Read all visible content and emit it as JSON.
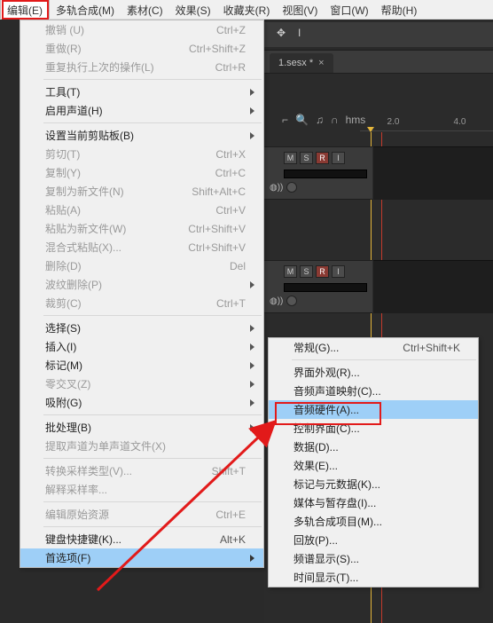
{
  "menubar": {
    "items": [
      {
        "label": "编辑(E)"
      },
      {
        "label": "多轨合成(M)"
      },
      {
        "label": "素材(C)"
      },
      {
        "label": "效果(S)"
      },
      {
        "label": "收藏夹(R)"
      },
      {
        "label": "视图(V)"
      },
      {
        "label": "窗口(W)"
      },
      {
        "label": "帮助(H)"
      }
    ]
  },
  "edit_menu": {
    "undo": {
      "label": "撤销 (U)",
      "shortcut": "Ctrl+Z"
    },
    "redo": {
      "label": "重做(R)",
      "shortcut": "Ctrl+Shift+Z"
    },
    "repeat": {
      "label": "重复执行上次的操作(L)",
      "shortcut": "Ctrl+R"
    },
    "tools": {
      "label": "工具(T)"
    },
    "enable_ch": {
      "label": "启用声道(H)"
    },
    "set_clipb": {
      "label": "设置当前剪贴板(B)"
    },
    "cut": {
      "label": "剪切(T)",
      "shortcut": "Ctrl+X"
    },
    "copy": {
      "label": "复制(Y)",
      "shortcut": "Ctrl+C"
    },
    "copy_new": {
      "label": "复制为新文件(N)",
      "shortcut": "Shift+Alt+C"
    },
    "paste": {
      "label": "粘贴(A)",
      "shortcut": "Ctrl+V"
    },
    "paste_new": {
      "label": "粘贴为新文件(W)",
      "shortcut": "Ctrl+Shift+V"
    },
    "mix_paste": {
      "label": "混合式粘贴(X)...",
      "shortcut": "Ctrl+Shift+V"
    },
    "delete": {
      "label": "删除(D)",
      "shortcut": "Del"
    },
    "ripple_del": {
      "label": "波纹删除(P)"
    },
    "crop": {
      "label": "裁剪(C)",
      "shortcut": "Ctrl+T"
    },
    "select": {
      "label": "选择(S)"
    },
    "insert": {
      "label": "插入(I)"
    },
    "marker": {
      "label": "标记(M)"
    },
    "zero_x": {
      "label": "零交叉(Z)"
    },
    "snap": {
      "label": "吸附(G)"
    },
    "batch": {
      "label": "批处理(B)"
    },
    "extract": {
      "label": "提取声道为单声道文件(X)"
    },
    "conv_sr": {
      "label": "转换采样类型(V)...",
      "shortcut": "Shift+T"
    },
    "interp_sr": {
      "label": "解释采样率..."
    },
    "edit_orig": {
      "label": "编辑原始资源",
      "shortcut": "Ctrl+E"
    },
    "keyb": {
      "label": "键盘快捷键(K)...",
      "shortcut": "Alt+K"
    },
    "prefs": {
      "label": "首选项(F)"
    }
  },
  "prefs_submenu": {
    "general": {
      "label": "常规(G)...",
      "shortcut": "Ctrl+Shift+K"
    },
    "appearance": {
      "label": "界面外观(R)..."
    },
    "chan_map": {
      "label": "音频声道映射(C)..."
    },
    "audio_hw": {
      "label": "音频硬件(A)..."
    },
    "ctrl_surf": {
      "label": "控制界面(C)..."
    },
    "data": {
      "label": "数据(D)..."
    },
    "effects": {
      "label": "效果(E)..."
    },
    "mark_meta": {
      "label": "标记与元数据(K)..."
    },
    "media_cache": {
      "label": "媒体与暂存盘(I)..."
    },
    "multitrack": {
      "label": "多轨合成项目(M)..."
    },
    "playback": {
      "label": "回放(P)..."
    },
    "spectral": {
      "label": "频谱显示(S)..."
    },
    "time_disp": {
      "label": "时间显示(T)..."
    }
  },
  "workspace": {
    "tab": {
      "label": "1.sesx *"
    },
    "ruler": {
      "unit": "hms",
      "ticks": [
        "2.0",
        "4.0"
      ]
    },
    "track_buttons": [
      "M",
      "S",
      "R",
      "I"
    ]
  }
}
